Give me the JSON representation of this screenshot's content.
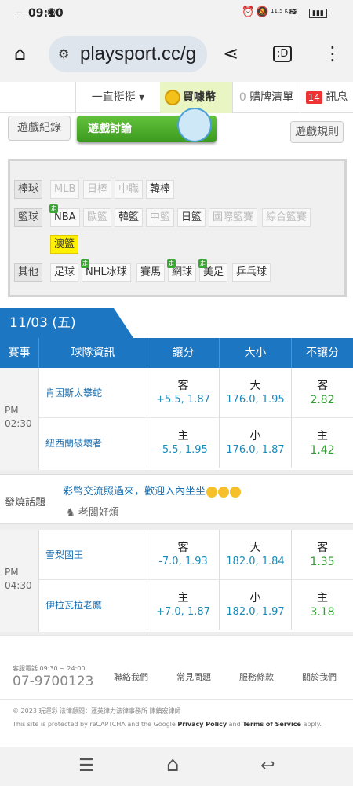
{
  "status": {
    "time": "09:10",
    "signal": "....",
    "netspeed": "11.5 KB/s"
  },
  "browser": {
    "url": "playsport.cc/g",
    "home_icon": "home-icon",
    "share_icon": "share-icon",
    "tab_count": ":D",
    "menu_icon": "more-vert-icon"
  },
  "topnav": {
    "dropdown": "一直挺挺 ▾",
    "buy": "買噱幣",
    "cart_count": "0",
    "cart": "購牌清單",
    "msg_count": "14",
    "msg": "訊息"
  },
  "game_buttons": {
    "record": "遊戲紀錄",
    "discussion": "遊戲討論",
    "rules": "遊戲規則"
  },
  "filter": {
    "baseball": {
      "label": "棒球",
      "items": [
        "MLB",
        "日棒",
        "中職",
        "韓棒"
      ]
    },
    "basketball": {
      "label": "籃球",
      "items": [
        "NBA",
        "歐籃",
        "韓籃",
        "中籃",
        "日籃",
        "國際籃賽",
        "綜合籃賽",
        "澳籃"
      ]
    },
    "other": {
      "label": "其他",
      "items": [
        "足球",
        "NHL冰球",
        "賽馬",
        "網球",
        "美足",
        "乒乓球"
      ]
    },
    "live_badge": "走"
  },
  "date": "11/03 (五)",
  "table_headers": [
    "賽事",
    "球隊資訊",
    "讓分",
    "大小",
    "不讓分"
  ],
  "games": [
    {
      "ampm": "PM",
      "time": "02:30",
      "rows": [
        {
          "team": "肯因斯太攀蛇",
          "spread_t": "客",
          "spread_v": "+5.5, 1.87",
          "total_t": "大",
          "total_v": "176.0, 1.95",
          "ml_t": "客",
          "ml_v": "2.82"
        },
        {
          "team": "紐西蘭破壞者",
          "spread_t": "主",
          "spread_v": "-5.5, 1.95",
          "total_t": "小",
          "total_v": "176.0, 1.87",
          "ml_t": "主",
          "ml_v": "1.42"
        }
      ]
    },
    {
      "ampm": "PM",
      "time": "04:30",
      "rows": [
        {
          "team": "雪梨國王",
          "spread_t": "客",
          "spread_v": "-7.0, 1.93",
          "total_t": "大",
          "total_v": "182.0, 1.84",
          "ml_t": "客",
          "ml_v": "1.35"
        },
        {
          "team": "伊拉瓦拉老鷹",
          "spread_t": "主",
          "spread_v": "+7.0, 1.87",
          "total_t": "小",
          "total_v": "182.0, 1.97",
          "ml_t": "主",
          "ml_v": "3.18"
        }
      ]
    }
  ],
  "hot_topic": {
    "label": "發燒話題",
    "title": "彩幣交流照過來，歡迎入內坐坐",
    "author": "老闆好煩"
  },
  "footer": {
    "phone_label": "客服電話 09:30 ~ 24:00",
    "phone": "07-9700123",
    "links": [
      "聯絡我們",
      "常見問題",
      "服務條款",
      "關於我們"
    ],
    "copyright": "© 2023 玩運彩 法律顧問：滙英律力法律事務所 陳鎮宏律師",
    "captcha_pre": "This site is protected by reCAPTCHA and the Google ",
    "privacy": "Privacy Policy",
    "and": " and ",
    "terms": "Terms of Service",
    "apply": " apply."
  },
  "navbar": {
    "recent": "☰",
    "home": "⌂",
    "back": "↩"
  }
}
